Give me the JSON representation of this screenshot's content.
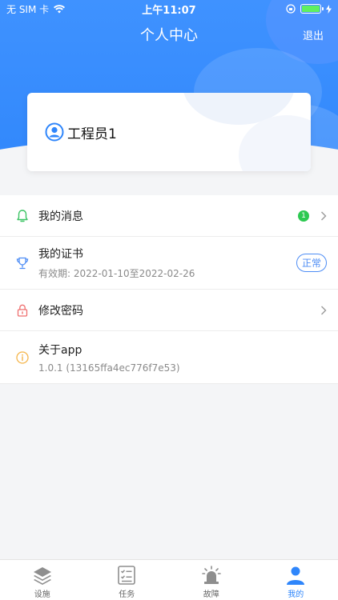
{
  "status_bar": {
    "carrier": "无 SIM 卡",
    "time": "上午11:07"
  },
  "nav": {
    "title": "个人中心",
    "logout": "退出"
  },
  "profile": {
    "username": "工程员1"
  },
  "menu": {
    "messages": {
      "label": "我的消息",
      "badge": "1"
    },
    "certificate": {
      "label": "我的证书",
      "validity": "有效期: 2022-01-10至2022-02-26",
      "status": "正常"
    },
    "password": {
      "label": "修改密码"
    },
    "about": {
      "label": "关于app",
      "version": "1.0.1 (13165ffa4ec776f7e53)"
    }
  },
  "tabs": [
    {
      "label": "设施",
      "icon": "layers-icon"
    },
    {
      "label": "任务",
      "icon": "task-list-icon"
    },
    {
      "label": "故障",
      "icon": "alarm-light-icon"
    },
    {
      "label": "我的",
      "icon": "person-icon",
      "active": true
    }
  ],
  "colors": {
    "primary": "#2f86fb",
    "badge": "#2dc951",
    "background": "#f4f5f7"
  }
}
